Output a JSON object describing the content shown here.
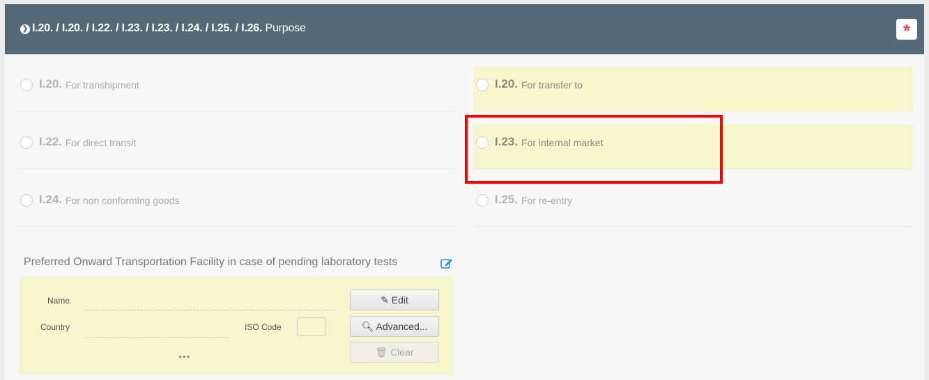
{
  "header": {
    "codes": "I.20. / I.20. / I.22. / I.23. / I.23. / I.24. / I.25. / I.26.",
    "label": "Purpose",
    "required_marker": "*",
    "chevron_icon": "chevron-circle-right-icon"
  },
  "options": [
    {
      "code": "I.20.",
      "text": "For transhipment",
      "highlighted": false
    },
    {
      "code": "I.20.",
      "text": "For transfer to",
      "highlighted": true
    },
    {
      "code": "I.22.",
      "text": "For direct transit",
      "highlighted": false
    },
    {
      "code": "I.23.",
      "text": "For internal market",
      "highlighted": true
    },
    {
      "code": "I.24.",
      "text": "For non conforming goods",
      "highlighted": false
    },
    {
      "code": "I.25.",
      "text": "For re-entry",
      "highlighted": false
    }
  ],
  "facility": {
    "title": "Preferred Onward Transportation Facility in case of pending laboratory tests",
    "name_label": "Name",
    "country_label": "Country",
    "iso_label": "ISO Code",
    "more": "•••",
    "edit_label": "Edit",
    "advanced_label": "Advanced...",
    "clear_label": "Clear"
  },
  "colors": {
    "header_bg": "#546a78",
    "highlight_bg": "#f7f5cc",
    "annotation_red": "#ff0000",
    "required_red": "#d9534f"
  }
}
